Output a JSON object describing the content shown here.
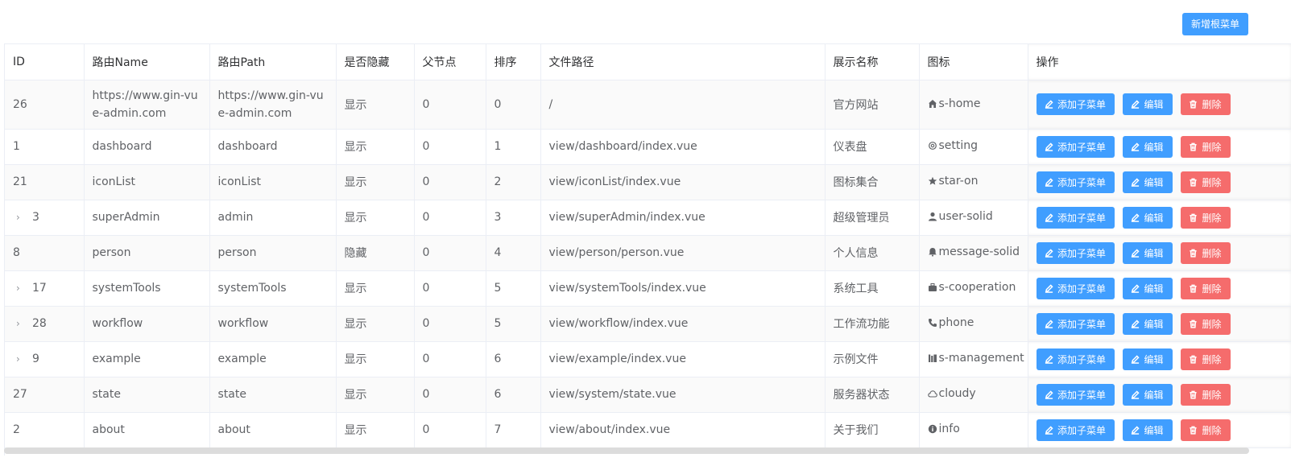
{
  "toolbar": {
    "add_root_label": "新增根菜单"
  },
  "table": {
    "headers": [
      "ID",
      "路由Name",
      "路由Path",
      "是否隐藏",
      "父节点",
      "排序",
      "文件路径",
      "展示名称",
      "图标",
      "操作"
    ],
    "ops": {
      "add_child": "添加子菜单",
      "edit": "编辑",
      "delete": "删除"
    },
    "rows": [
      {
        "id": "26",
        "expandable": false,
        "name": "https://www.gin-vue-admin.com",
        "path": "https://www.gin-vue-admin.com",
        "hidden": "显示",
        "parent": "0",
        "sort": "0",
        "file": "/",
        "title": "官方网站",
        "icon": "s-home"
      },
      {
        "id": "1",
        "expandable": false,
        "name": "dashboard",
        "path": "dashboard",
        "hidden": "显示",
        "parent": "0",
        "sort": "1",
        "file": "view/dashboard/index.vue",
        "title": "仪表盘",
        "icon": "setting"
      },
      {
        "id": "21",
        "expandable": false,
        "name": "iconList",
        "path": "iconList",
        "hidden": "显示",
        "parent": "0",
        "sort": "2",
        "file": "view/iconList/index.vue",
        "title": "图标集合",
        "icon": "star-on"
      },
      {
        "id": "3",
        "expandable": true,
        "name": "superAdmin",
        "path": "admin",
        "hidden": "显示",
        "parent": "0",
        "sort": "3",
        "file": "view/superAdmin/index.vue",
        "title": "超级管理员",
        "icon": "user-solid"
      },
      {
        "id": "8",
        "expandable": false,
        "name": "person",
        "path": "person",
        "hidden": "隐藏",
        "parent": "0",
        "sort": "4",
        "file": "view/person/person.vue",
        "title": "个人信息",
        "icon": "message-solid"
      },
      {
        "id": "17",
        "expandable": true,
        "name": "systemTools",
        "path": "systemTools",
        "hidden": "显示",
        "parent": "0",
        "sort": "5",
        "file": "view/systemTools/index.vue",
        "title": "系统工具",
        "icon": "s-cooperation"
      },
      {
        "id": "28",
        "expandable": true,
        "name": "workflow",
        "path": "workflow",
        "hidden": "显示",
        "parent": "0",
        "sort": "5",
        "file": "view/workflow/index.vue",
        "title": "工作流功能",
        "icon": "phone"
      },
      {
        "id": "9",
        "expandable": true,
        "name": "example",
        "path": "example",
        "hidden": "显示",
        "parent": "0",
        "sort": "6",
        "file": "view/example/index.vue",
        "title": "示例文件",
        "icon": "s-management"
      },
      {
        "id": "27",
        "expandable": false,
        "name": "state",
        "path": "state",
        "hidden": "显示",
        "parent": "0",
        "sort": "6",
        "file": "view/system/state.vue",
        "title": "服务器状态",
        "icon": "cloudy"
      },
      {
        "id": "2",
        "expandable": false,
        "name": "about",
        "path": "about",
        "hidden": "显示",
        "parent": "0",
        "sort": "7",
        "file": "view/about/index.vue",
        "title": "关于我们",
        "icon": "info"
      }
    ]
  },
  "colors": {
    "primary": "#409eff",
    "danger": "#f56c6c",
    "border": "#ebeef5",
    "text": "#606266",
    "header_text": "#303133"
  }
}
